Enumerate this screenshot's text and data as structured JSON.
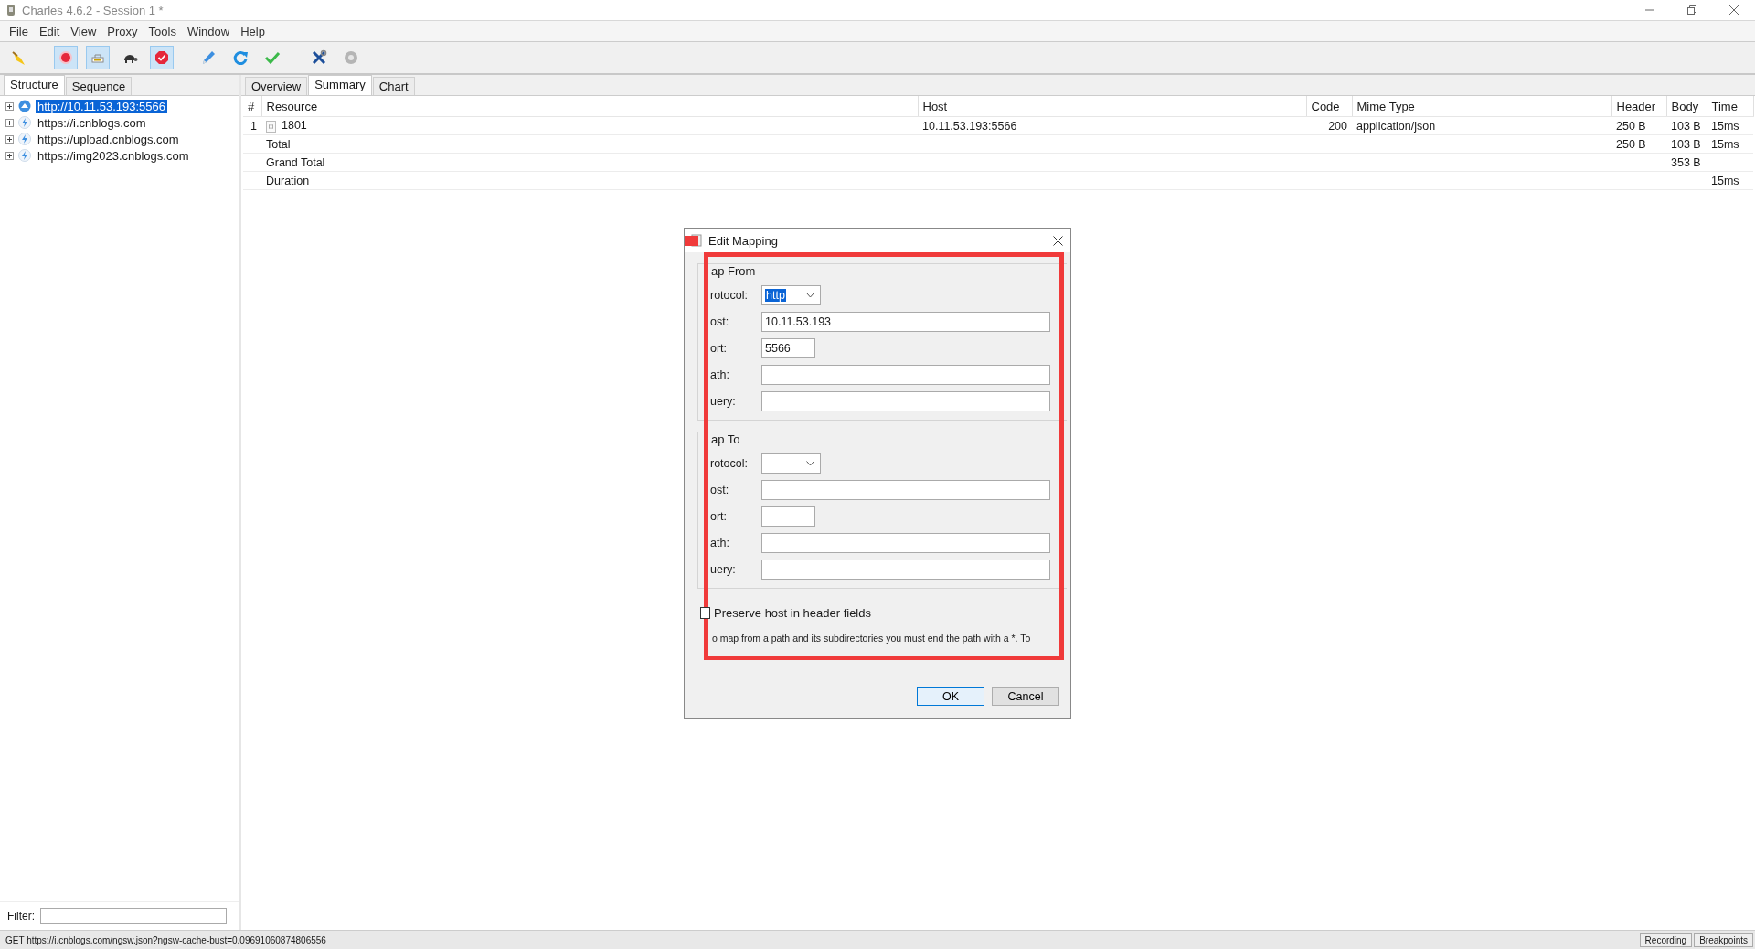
{
  "window": {
    "title": "Charles 4.6.2 - Session 1 *"
  },
  "menu": [
    "File",
    "Edit",
    "View",
    "Proxy",
    "Tools",
    "Window",
    "Help"
  ],
  "toolbar": [
    {
      "kind": "broom",
      "pressed": false
    },
    {
      "kind": "record",
      "pressed": true
    },
    {
      "kind": "throttle",
      "pressed": true
    },
    {
      "kind": "turtle",
      "pressed": false
    },
    {
      "kind": "breakpoint",
      "pressed": true
    },
    {
      "kind": "pen",
      "pressed": false
    },
    {
      "kind": "refresh",
      "pressed": false
    },
    {
      "kind": "check",
      "pressed": false
    },
    {
      "kind": "tools",
      "pressed": false
    },
    {
      "kind": "gear",
      "pressed": false
    }
  ],
  "left_tabs": [
    {
      "label": "Structure",
      "selected": true
    },
    {
      "label": "Sequence",
      "selected": false
    }
  ],
  "tree": [
    {
      "label": "http://10.11.53.193:5566",
      "kind": "http",
      "selected": true
    },
    {
      "label": "https://i.cnblogs.com",
      "kind": "https",
      "selected": false
    },
    {
      "label": "https://upload.cnblogs.com",
      "kind": "https",
      "selected": false
    },
    {
      "label": "https://img2023.cnblogs.com",
      "kind": "https",
      "selected": false
    }
  ],
  "filter": {
    "label": "Filter:"
  },
  "right_tabs": [
    {
      "label": "Overview",
      "selected": false
    },
    {
      "label": "Summary",
      "selected": true
    },
    {
      "label": "Chart",
      "selected": false
    }
  ],
  "table": {
    "columns": [
      "#",
      "Resource",
      "Host",
      "Code",
      "Mime Type",
      "Header",
      "Body",
      "Time"
    ],
    "rows": [
      {
        "kind": "request",
        "cells": [
          "1",
          "1801",
          "10.11.53.193:5566",
          "200",
          "application/json",
          "250 B",
          "103 B",
          "15ms"
        ]
      },
      {
        "kind": "summary",
        "cells": [
          "",
          "Total",
          "",
          "",
          "",
          "250 B",
          "103 B",
          "15ms"
        ]
      },
      {
        "kind": "summary",
        "cells": [
          "",
          "Grand Total",
          "",
          "",
          "",
          "",
          "353 B",
          ""
        ]
      },
      {
        "kind": "summary",
        "cells": [
          "",
          "Duration",
          "",
          "",
          "",
          "",
          "",
          "15ms"
        ]
      }
    ]
  },
  "dialog": {
    "title": "Edit Mapping",
    "sections": [
      {
        "title": "ap From",
        "fields": [
          {
            "label": "rotocol:",
            "kind": "select",
            "value": "http",
            "highlighted": true
          },
          {
            "label": "ost:",
            "kind": "text",
            "value": "10.11.53.193"
          },
          {
            "label": "ort:",
            "kind": "short",
            "value": "5566"
          },
          {
            "label": "ath:",
            "kind": "text"
          },
          {
            "label": "uery:",
            "kind": "text"
          }
        ]
      },
      {
        "title": "ap To",
        "fields": [
          {
            "label": "rotocol:",
            "kind": "select"
          },
          {
            "label": "ost:",
            "kind": "text"
          },
          {
            "label": "ort:",
            "kind": "short"
          },
          {
            "label": "ath:",
            "kind": "text"
          },
          {
            "label": "uery:",
            "kind": "text"
          }
        ]
      }
    ],
    "checkbox": {
      "label": "Preserve host in header fields",
      "checked": false
    },
    "help": "o map from a path and its subdirectories you must end the path with a *. To",
    "buttons": [
      {
        "label": "OK",
        "default": true
      },
      {
        "label": "Cancel",
        "default": false
      }
    ]
  },
  "status_bar": {
    "text": "GET https://i.cnblogs.com/ngsw.json?ngsw-cache-bust=0.09691060874806556",
    "buttons": [
      "Recording",
      "Breakpoints"
    ]
  }
}
